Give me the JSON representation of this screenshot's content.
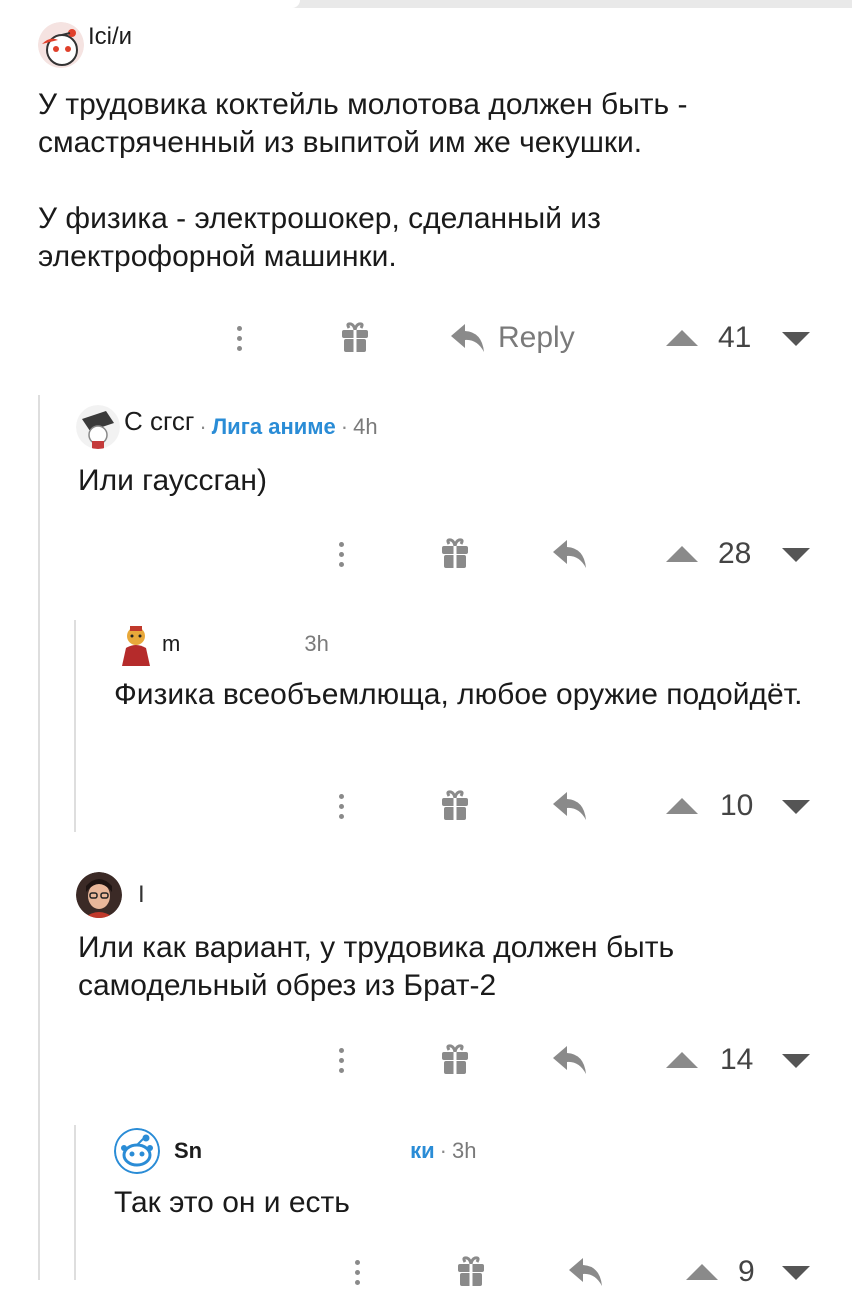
{
  "comments": [
    {
      "username": "Ici/и",
      "community": "",
      "time": "",
      "body": [
        "У трудовика коктейль молотова должен быть - смастряченный из выпитой им же чекушки.",
        "У физика - электрошокер, сделанный из электрофорной машинки."
      ],
      "reply_label": "Reply",
      "score": "41"
    },
    {
      "username": "С сгсг",
      "community": "Лига аниме",
      "time": "4h",
      "body": [
        "Или гауссган)"
      ],
      "reply_label": "",
      "score": "28"
    },
    {
      "username": "m",
      "community": "",
      "time": "3h",
      "body": [
        "Физика всеобъемлюща, любое оружие подойдёт."
      ],
      "reply_label": "",
      "score": "10"
    },
    {
      "username": "I",
      "community": "",
      "time": "",
      "body": [
        "Или как вариант, у трудовика должен быть самодельный обрез из Брат-2"
      ],
      "reply_label": "",
      "score": "14"
    },
    {
      "username": "Sn",
      "community": "ки",
      "time": "3h",
      "body": [
        "Так это он и есть"
      ],
      "reply_label": "",
      "score": "9"
    }
  ],
  "colors": {
    "community": "#2a8cd6",
    "icon": "#8a8a8a",
    "thread_line": "#dedede"
  },
  "icons": [
    "more-vertical-icon",
    "gift-icon",
    "reply-arrow-icon",
    "upvote-arrow-icon",
    "downvote-arrow-icon"
  ]
}
